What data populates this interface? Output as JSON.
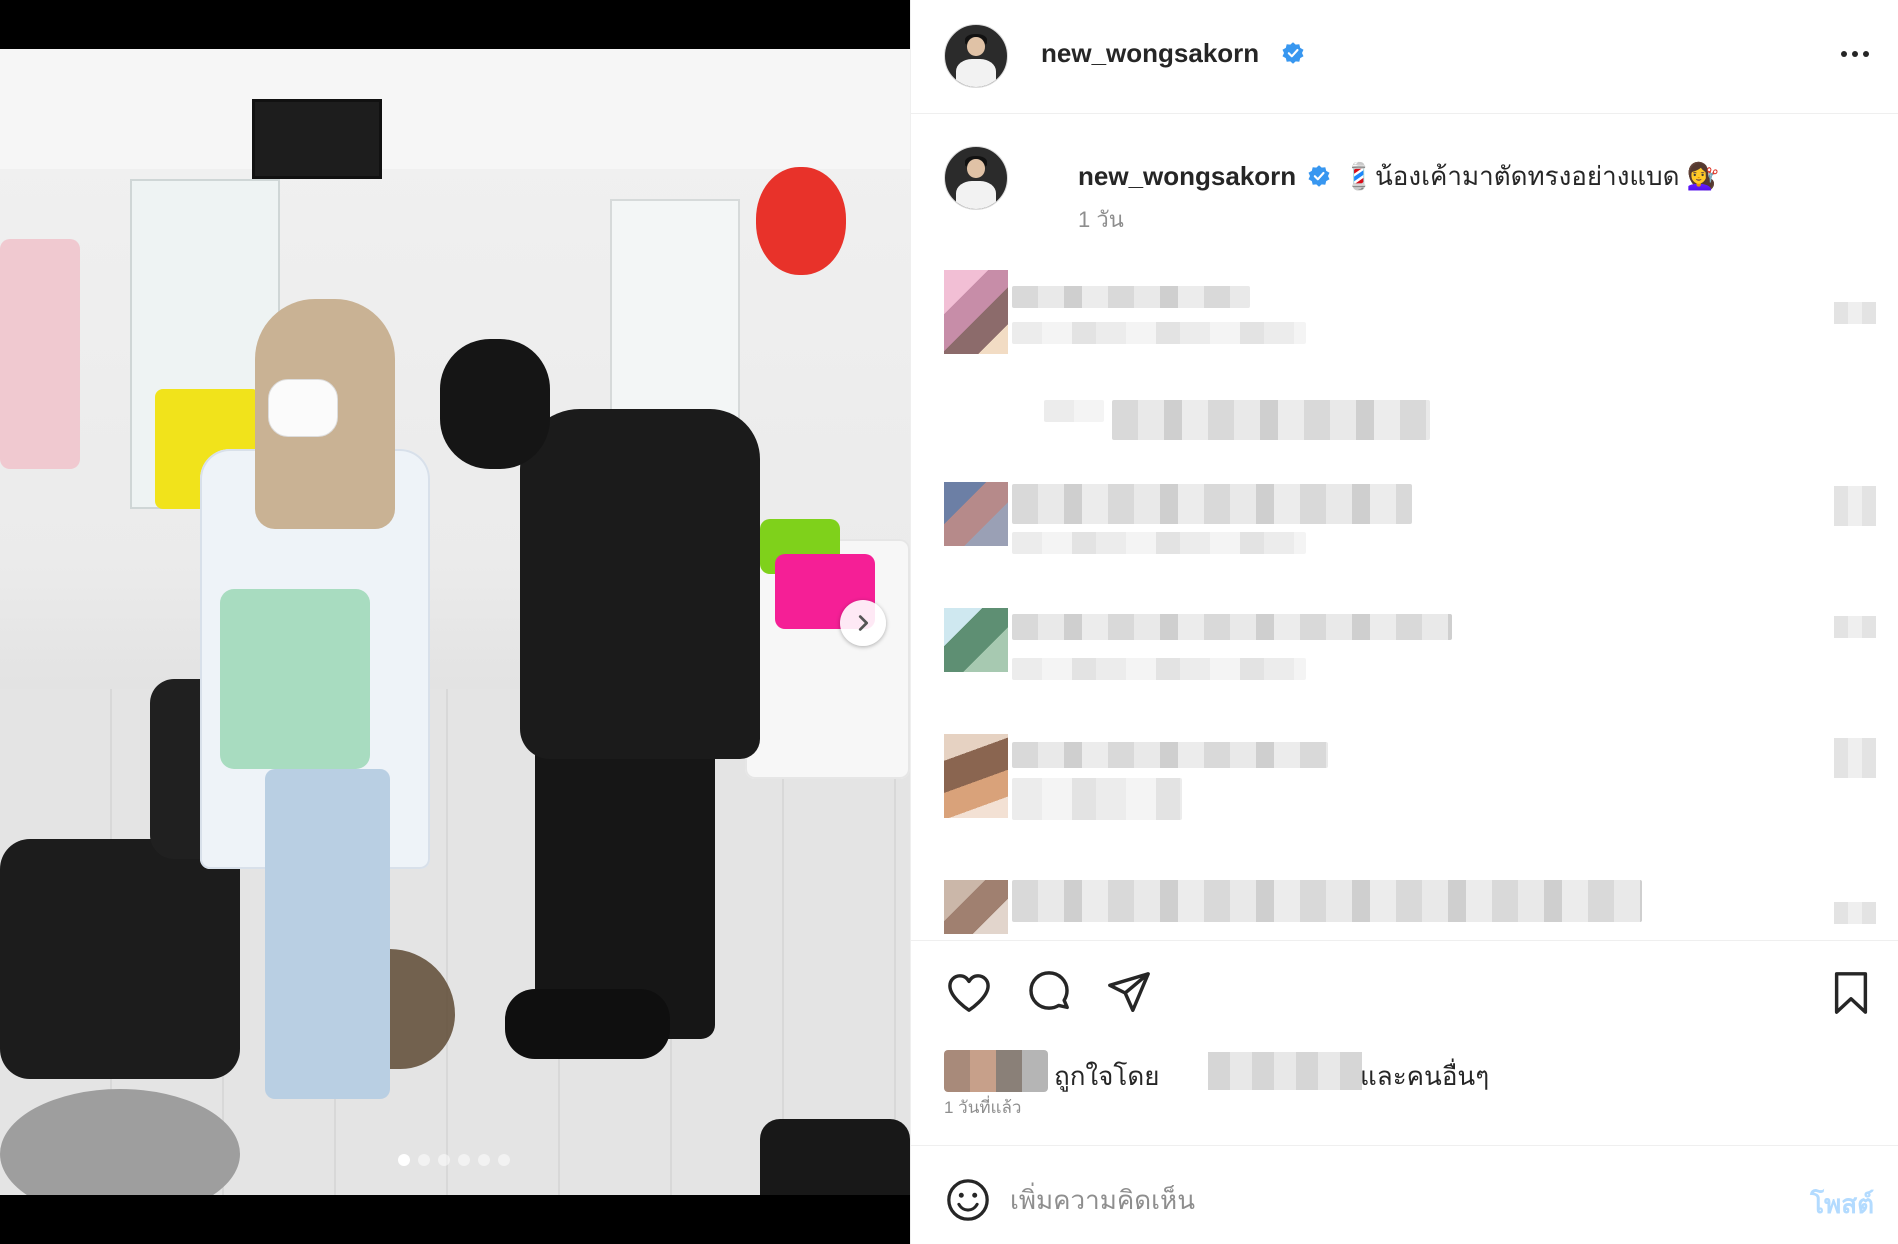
{
  "post": {
    "username": "new_wongsakorn",
    "caption": "💈น้องเค้ามาตัดทรงอย่างแบด 💇‍♀️",
    "caption_time": "1 วัน",
    "carousel": {
      "total_slides": 6,
      "active_slide": 1
    }
  },
  "header": {
    "username": "new_wongsakorn",
    "more_icon": "more-horizontal-icon"
  },
  "icons": {
    "like": "heart-icon",
    "comment": "comment-bubble-icon",
    "share": "paper-plane-icon",
    "save": "bookmark-icon",
    "verified": "verified-badge-icon",
    "next": "chevron-right-icon",
    "emoji": "smiley-icon"
  },
  "colors": {
    "verified_blue": "#3897f0",
    "post_button_disabled": "#b3dbff",
    "secondary_text": "#8e8e8e"
  },
  "likes": {
    "prefix": "ถูกใจโดย",
    "suffix": "และคนอื่นๆ"
  },
  "timestamp": "1 วันที่แล้ว",
  "comment_box": {
    "placeholder": "เพิ่มความคิดเห็น",
    "post_label": "โพสต์"
  }
}
